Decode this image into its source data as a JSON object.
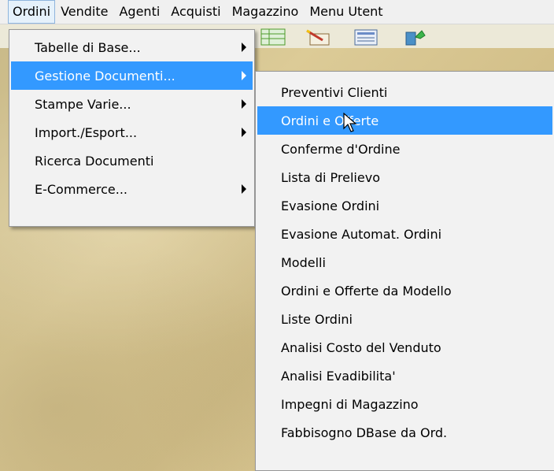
{
  "menubar": {
    "items": [
      "Ordini",
      "Vendite",
      "Agenti",
      "Acquisti",
      "Magazzino",
      "Menu Utent"
    ]
  },
  "ordini_menu": {
    "items": [
      {
        "label": "Tabelle di Base...",
        "has_submenu": true
      },
      {
        "label": "Gestione Documenti...",
        "has_submenu": true,
        "selected": true
      },
      {
        "label": "Stampe Varie...",
        "has_submenu": true
      },
      {
        "label": "Import./Esport...",
        "has_submenu": true
      },
      {
        "label": "Ricerca Documenti",
        "has_submenu": false
      },
      {
        "label": "E-Commerce...",
        "has_submenu": true
      }
    ]
  },
  "gestione_documenti_submenu": {
    "items": [
      {
        "label": "Preventivi Clienti"
      },
      {
        "label": "Ordini e Offerte",
        "selected": true
      },
      {
        "label": "Conferme d'Ordine"
      },
      {
        "label": "Lista di Prelievo"
      },
      {
        "label": "Evasione Ordini"
      },
      {
        "label": "Evasione Automat. Ordini"
      },
      {
        "label": "Modelli"
      },
      {
        "label": "Ordini e Offerte da Modello"
      },
      {
        "label": "Liste Ordini"
      },
      {
        "label": "Analisi Costo del Venduto"
      },
      {
        "label": "Analisi Evadibilita'"
      },
      {
        "label": "Impegni di Magazzino"
      },
      {
        "label": "Fabbisogno DBase da Ord."
      }
    ]
  },
  "colors": {
    "highlight": "#3399ff",
    "menu_background": "#f2f2f2",
    "desktop": "#d9c99a"
  },
  "icons": [
    "spreadsheet-icon",
    "pencil-document-icon",
    "form-document-icon",
    "recycle-icon"
  ]
}
